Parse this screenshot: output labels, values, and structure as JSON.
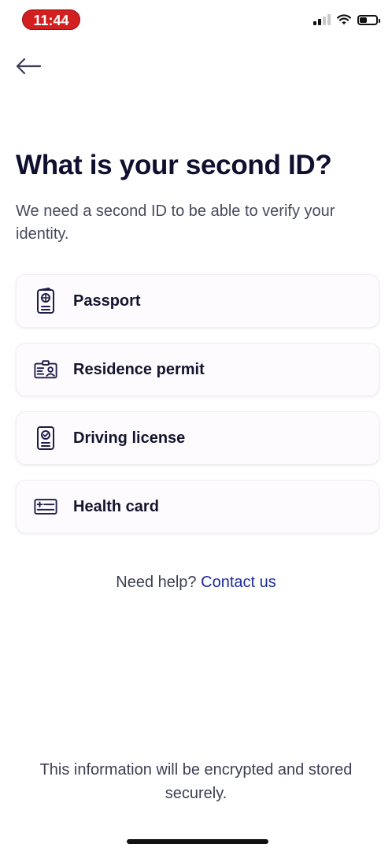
{
  "status_bar": {
    "time": "11:44",
    "time_pill_color": "#d21f1f",
    "battery_level": 0.45
  },
  "header": {
    "back_icon": "arrow-left-icon"
  },
  "page": {
    "title": "What is your second ID?",
    "subtitle": "We need a second ID to be able to verify your identity."
  },
  "options": [
    {
      "label": "Passport",
      "icon": "passport-icon"
    },
    {
      "label": "Residence permit",
      "icon": "residence-permit-icon"
    },
    {
      "label": "Driving license",
      "icon": "driving-license-icon"
    },
    {
      "label": "Health card",
      "icon": "health-card-icon"
    }
  ],
  "help": {
    "text": "Need help?",
    "link_label": "Contact us"
  },
  "footer": {
    "note": "This information will be encrypted and stored securely."
  },
  "colors": {
    "title": "#0f1030",
    "link": "#1d2a9e",
    "card_background": "#fdfbfd"
  }
}
